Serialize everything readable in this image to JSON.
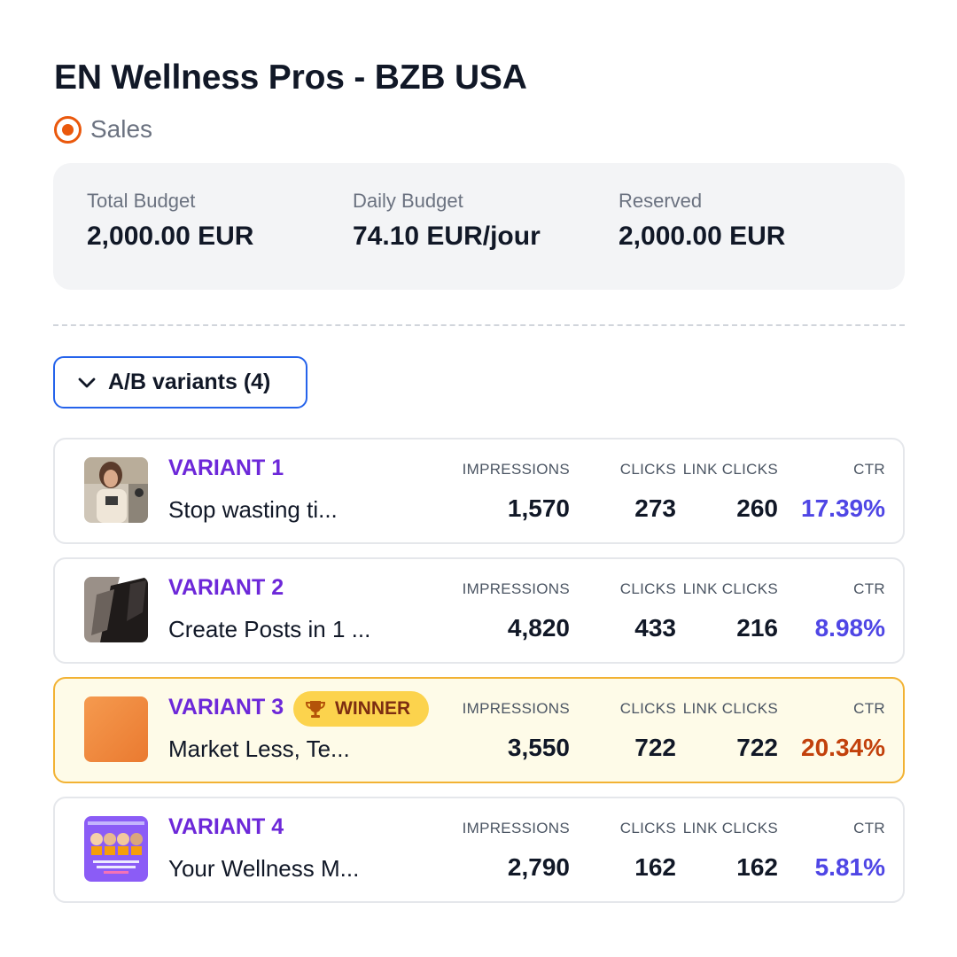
{
  "campaign": {
    "title": "EN Wellness Pros - BZB USA",
    "objective": "Sales",
    "objective_icon": "target-icon"
  },
  "budget": {
    "total_label": "Total Budget",
    "total_value": "2,000.00 EUR",
    "daily_label": "Daily Budget",
    "daily_value": "74.10 EUR/jour",
    "reserved_label": "Reserved",
    "reserved_value": "2,000.00 EUR"
  },
  "variants_toggle": {
    "label": "A/B variants (4)",
    "icon": "chevron-down-icon"
  },
  "columns": {
    "impressions": "IMPRESSIONS",
    "clicks": "CLICKS",
    "link_clicks": "LINK CLICKS",
    "ctr": "CTR"
  },
  "winner_badge": "WINNER",
  "variants": [
    {
      "name": "VARIANT 1",
      "headline": "Stop wasting ti...",
      "impressions": "1,570",
      "clicks": "273",
      "link_clicks": "260",
      "ctr": "17.39%",
      "winner": false
    },
    {
      "name": "VARIANT 2",
      "headline": "Create Posts in 1 ...",
      "impressions": "4,820",
      "clicks": "433",
      "link_clicks": "216",
      "ctr": "8.98%",
      "winner": false
    },
    {
      "name": "VARIANT 3",
      "headline": "Market Less, Te...",
      "impressions": "3,550",
      "clicks": "722",
      "link_clicks": "722",
      "ctr": "20.34%",
      "winner": true
    },
    {
      "name": "VARIANT 4",
      "headline": "Your Wellness M...",
      "impressions": "2,790",
      "clicks": "162",
      "link_clicks": "162",
      "ctr": "5.81%",
      "winner": false
    }
  ],
  "colors": {
    "accent_purple": "#6d28d9",
    "ctr_blue": "#4f46e5",
    "ctr_winner": "#c2410c",
    "winner_bg": "#fefbe8",
    "winner_border": "#f2b233",
    "toggle_border": "#2563eb",
    "objective_orange": "#ea580c"
  }
}
